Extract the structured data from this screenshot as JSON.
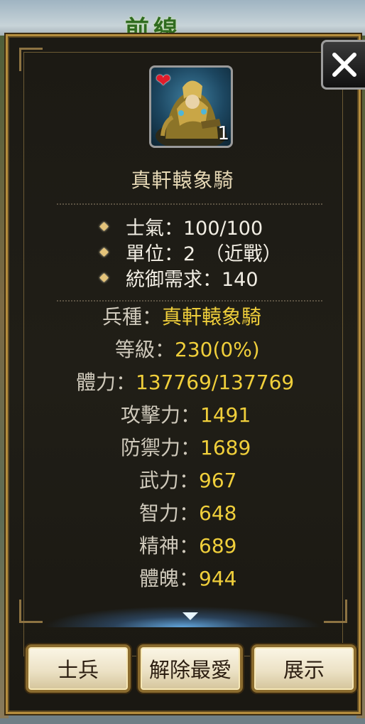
{
  "background": {
    "title": "前線"
  },
  "unit": {
    "name": "真軒轅象騎",
    "portrait_count": "1",
    "favorite_icon": "heart-icon"
  },
  "summary": [
    {
      "label": "士氣：100/100"
    },
    {
      "label": "單位：2　（近戰）"
    },
    {
      "label": "統御需求：140"
    }
  ],
  "stats": [
    {
      "label": "兵種：",
      "value": "真軒轅象騎"
    },
    {
      "label": "等級：",
      "value": "230(0%)"
    },
    {
      "label": "體力：",
      "value": "137769/137769"
    },
    {
      "label": "攻擊力：",
      "value": "1491"
    },
    {
      "label": "防禦力：",
      "value": "1689"
    },
    {
      "label": "武力：",
      "value": "967"
    },
    {
      "label": "智力：",
      "value": "648"
    },
    {
      "label": "精神：",
      "value": "689"
    },
    {
      "label": "體魄：",
      "value": "944"
    }
  ],
  "buttons": {
    "soldier": "士兵",
    "unfavorite": "解除最愛",
    "show": "展示"
  },
  "colors": {
    "value": "#f0cf3b",
    "label": "#cfc9bb",
    "frame": "#b58d3d"
  }
}
